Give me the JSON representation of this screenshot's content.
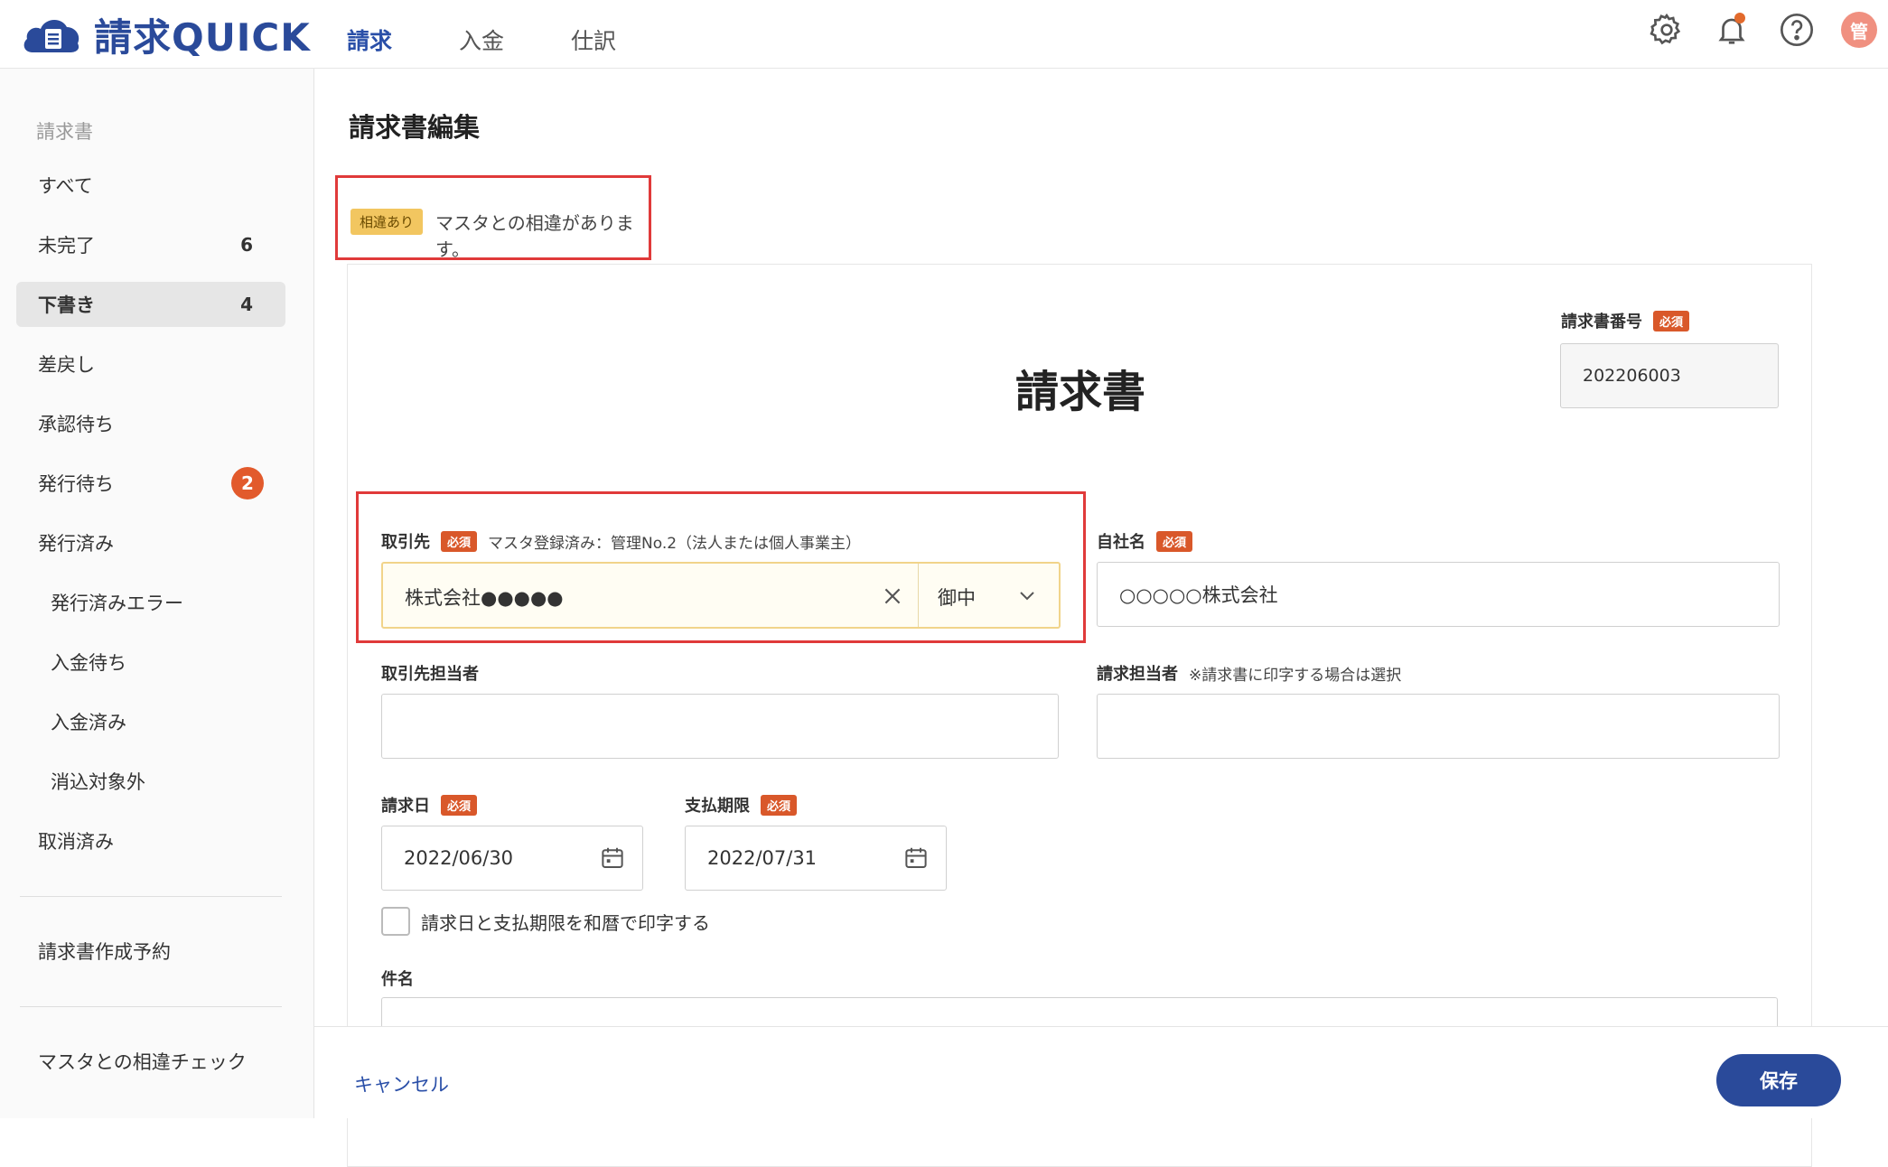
{
  "app": {
    "name": "請求QUICK"
  },
  "topnav": [
    {
      "label": "請求"
    },
    {
      "label": "入金"
    },
    {
      "label": "仕訳"
    }
  ],
  "sidebar": {
    "section": "請求書",
    "items": [
      {
        "label": "すべて"
      },
      {
        "label": "未完了",
        "count": "6"
      },
      {
        "label": "下書き",
        "count": "4"
      },
      {
        "label": "差戻し"
      },
      {
        "label": "承認待ち"
      },
      {
        "label": "発行待ち",
        "badge": "2"
      },
      {
        "label": "発行済み"
      },
      {
        "label": "発行済みエラー"
      },
      {
        "label": "入金待ち"
      },
      {
        "label": "入金済み"
      },
      {
        "label": "消込対象外"
      },
      {
        "label": "取消済み"
      }
    ],
    "reservation": "請求書作成予約",
    "master_check": "マスタとの相違チェック"
  },
  "page": {
    "title": "請求書編集",
    "alert_tag": "相違あり",
    "alert_text": "マスタとの相違があります。",
    "doc_title": "請求書"
  },
  "form": {
    "required": "必須",
    "invoice_no": {
      "label": "請求書番号",
      "value": "202206003"
    },
    "partner": {
      "label": "取引先",
      "note": "マスタ登録済み：管理No.2（法人または個人事業主）",
      "value": "株式会社●●●●●",
      "honorific": "御中"
    },
    "own_company": {
      "label": "自社名",
      "value": "○○○○○株式会社"
    },
    "partner_contact": {
      "label": "取引先担当者"
    },
    "billing_contact": {
      "label": "請求担当者",
      "note": "※請求書に印字する場合は選択"
    },
    "invoice_date": {
      "label": "請求日",
      "value": "2022/06/30"
    },
    "due_date": {
      "label": "支払期限",
      "value": "2022/07/31"
    },
    "wareki_checkbox": "請求日と支払期限を和暦で印字する",
    "subject": {
      "label": "件名"
    }
  },
  "footer": {
    "cancel": "キャンセル",
    "save": "保存"
  },
  "colors": {
    "accent": "#2a4a9a",
    "required": "#d9582a",
    "alert_border": "#e03a3a",
    "alert_tag": "#f2c660"
  }
}
